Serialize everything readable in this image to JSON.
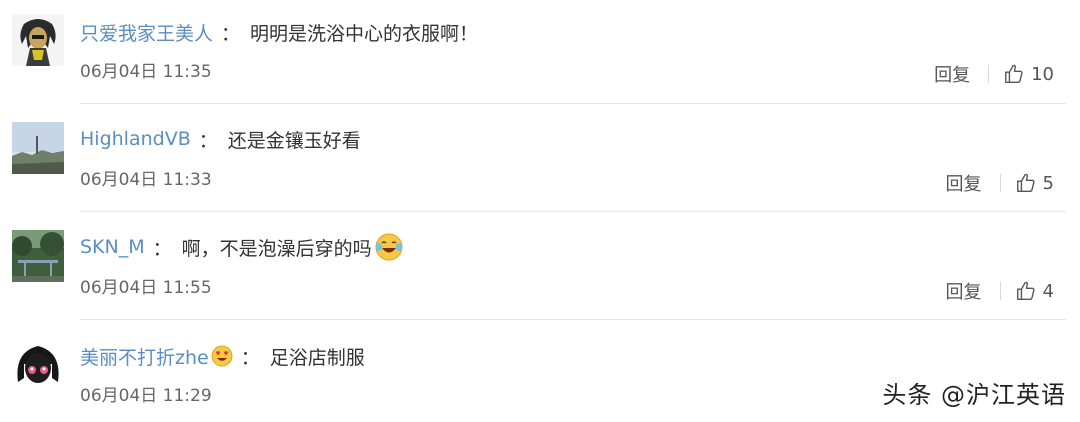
{
  "comments": [
    {
      "username": "只爱我家王美人",
      "colon": "：",
      "text": "明明是洗浴中心的衣服啊！",
      "time": "06月04日 11:35",
      "reply_label": "回复",
      "likes": "10",
      "avatar_icon": "cartoon-character-avatar"
    },
    {
      "username": "HighlandVB",
      "colon": "：",
      "text": "还是金镶玉好看",
      "time": "06月04日 11:33",
      "reply_label": "回复",
      "likes": "5",
      "avatar_icon": "landscape-photo-avatar"
    },
    {
      "username": "SKN_M",
      "colon": "：",
      "text": "啊，不是泡澡后穿的吗",
      "time": "06月04日 11:55",
      "reply_label": "回复",
      "likes": "4",
      "avatar_icon": "park-photo-avatar",
      "emoji_icon": "laughing-tears-emoji"
    },
    {
      "username": "美丽不打折zhe",
      "colon": "：",
      "text": "足浴店制服",
      "time": "06月04日 11:29",
      "badge_icon": "heart-eyes-emoji",
      "avatar_icon": "dark-hair-character-avatar"
    }
  ],
  "watermark": "头条 @沪江英语",
  "colors": {
    "username": "#5a8ec2",
    "text": "#333333",
    "muted": "#666666",
    "divider": "#e6e6e6"
  }
}
